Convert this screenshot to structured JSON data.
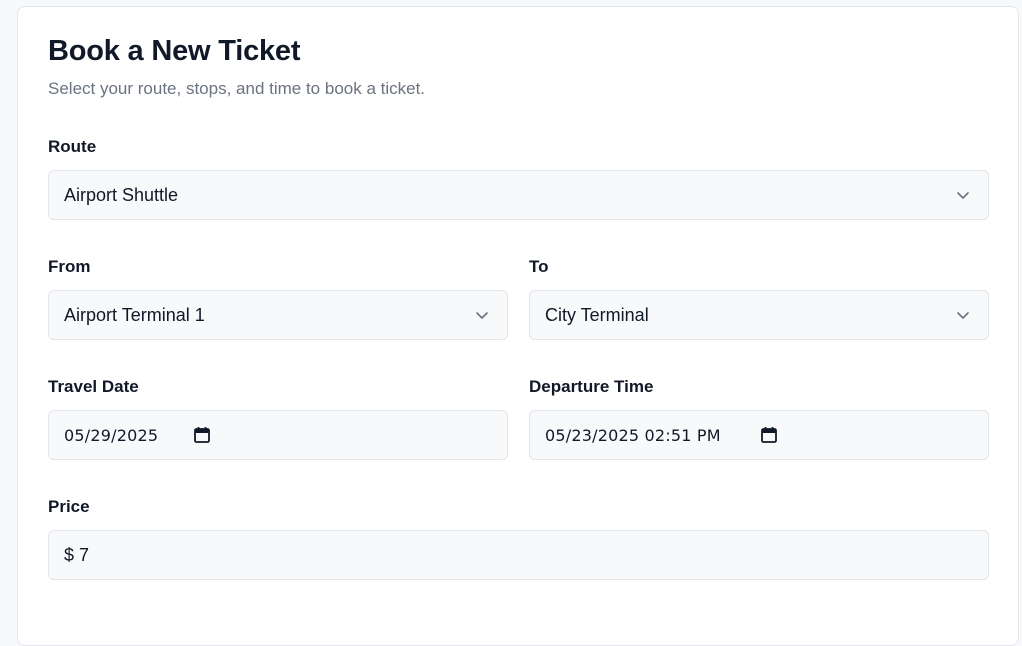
{
  "header": {
    "title": "Book a New Ticket",
    "subtitle": "Select your route, stops, and time to book a ticket."
  },
  "route": {
    "label": "Route",
    "value": "Airport Shuttle"
  },
  "from": {
    "label": "From",
    "value": "Airport Terminal 1"
  },
  "to": {
    "label": "To",
    "value": "City Terminal"
  },
  "travel_date": {
    "label": "Travel Date",
    "value": "05/29/2025"
  },
  "departure_time": {
    "label": "Departure Time",
    "value": "05/23/2025 02:51 PM"
  },
  "price": {
    "label": "Price",
    "value": "$ 7"
  },
  "icons": {
    "dropdown": "chevron-down-icon",
    "calendar": "calendar-icon"
  }
}
